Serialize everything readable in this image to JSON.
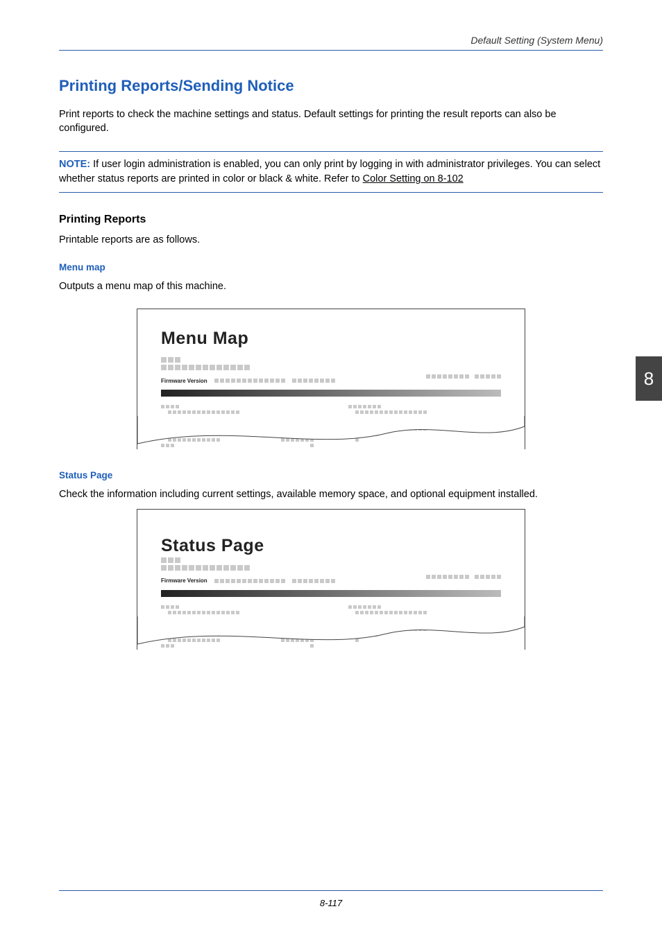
{
  "header": {
    "running_head": "Default Setting (System Menu)"
  },
  "section": {
    "title": "Printing Reports/Sending Notice",
    "intro": "Print reports to check the machine settings and status. Default settings for printing the result reports can also be configured."
  },
  "note": {
    "label": "NOTE:",
    "line1": " If user login administration is enabled, you can only print by logging in with administrator privileges. You can select whether status reports are printed in color or black & white. Refer to ",
    "xref": "Color Setting on 8-102"
  },
  "printing_reports": {
    "heading": "Printing Reports",
    "intro": "Printable reports are as follows."
  },
  "menu_map": {
    "heading4": "Menu map",
    "desc": "Outputs a menu map of this machine.",
    "sample_title": "Menu Map",
    "firmware_label": "Firmware Version"
  },
  "status_page": {
    "heading4": "Status Page",
    "desc": "Check the information including current settings, available memory space, and optional equipment installed.",
    "sample_title": "Status Page",
    "firmware_label": "Firmware Version"
  },
  "thumb_tab": "8",
  "footer": {
    "page_num": "8-117"
  }
}
